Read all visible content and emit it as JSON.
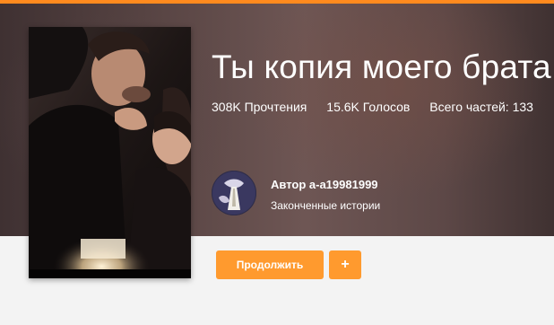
{
  "story": {
    "title": "Ты копия моего брата."
  },
  "stats": {
    "reads": "308K Прочтения",
    "votes": "15.6K Голосов",
    "parts": "Всего частей: 133"
  },
  "author": {
    "name": "Автор a-a19981999",
    "status": "Законченные истории"
  },
  "actions": {
    "continue_label": "Продолжить",
    "add_label": "+"
  },
  "colors": {
    "accent": "#ff9a2e",
    "top_bar": "#ff8a1e",
    "hero_background": "#5a4645",
    "page_background": "#f3f3f3"
  },
  "icons": {
    "cover": "story-cover-image",
    "avatar": "author-avatar-image"
  }
}
